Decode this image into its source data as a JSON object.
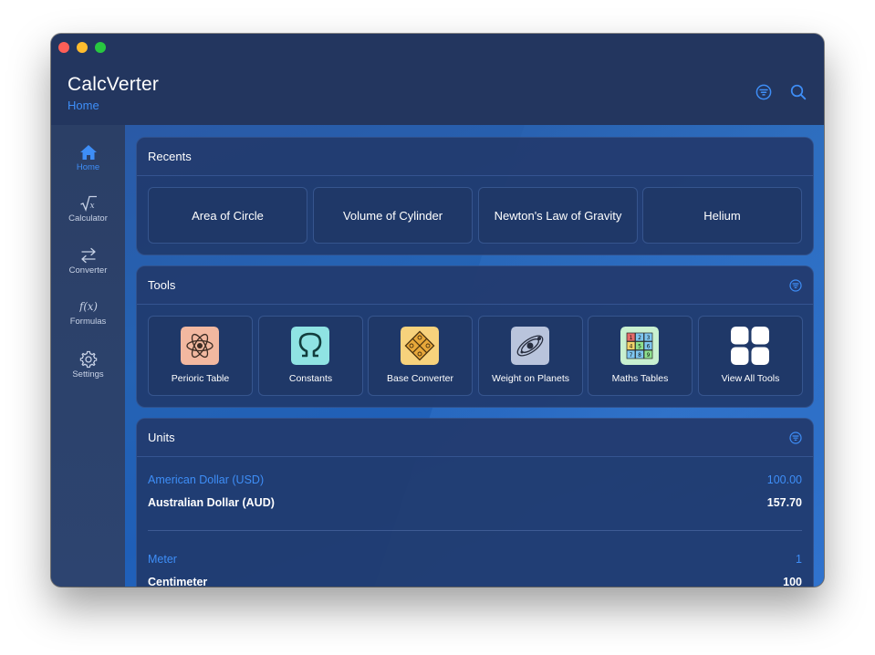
{
  "app": {
    "title": "CalcVerter",
    "subtitle": "Home"
  },
  "toolbar": {
    "filter_icon": "filter-circle-icon",
    "search_icon": "search-icon"
  },
  "sidebar": {
    "items": [
      {
        "label": "Home",
        "icon": "house-icon",
        "active": true
      },
      {
        "label": "Calculator",
        "icon": "square-root-icon",
        "active": false
      },
      {
        "label": "Converter",
        "icon": "arrows-left-right-icon",
        "active": false
      },
      {
        "label": "Formulas",
        "icon": "function-icon",
        "active": false
      },
      {
        "label": "Settings",
        "icon": "gear-icon",
        "active": false
      }
    ]
  },
  "recents": {
    "title": "Recents",
    "items": [
      "Area of Circle",
      "Volume of Cylinder",
      "Newton's Law of Gravity",
      "Helium"
    ]
  },
  "tools": {
    "title": "Tools",
    "items": [
      {
        "label": "Perioric Table",
        "icon": "atom-icon",
        "color": "#f2b8a0"
      },
      {
        "label": "Constants",
        "icon": "omega-icon",
        "color": "#8fe3e3"
      },
      {
        "label": "Base Converter",
        "icon": "base-diamond-icon",
        "color": "#f7d27c"
      },
      {
        "label": "Weight on Planets",
        "icon": "planet-icon",
        "color": "#b9c4dc"
      },
      {
        "label": "Maths Tables",
        "icon": "number-grid-icon",
        "color": "#c8f0d0"
      },
      {
        "label": "View All Tools",
        "icon": "grid-four-icon",
        "color": "#ffffff"
      }
    ]
  },
  "units": {
    "title": "Units",
    "groups": [
      {
        "from": {
          "name": "American Dollar (USD)",
          "value": "100.00"
        },
        "to": {
          "name": "Australian Dollar (AUD)",
          "value": "157.70"
        }
      },
      {
        "from": {
          "name": "Meter",
          "value": "1"
        },
        "to": {
          "name": "Centimeter",
          "value": "100"
        }
      }
    ]
  },
  "colors": {
    "accent": "#3e8ef7",
    "titlebar": "#23365f",
    "sidebar": "#2b3f66",
    "card": "#203a6e"
  }
}
